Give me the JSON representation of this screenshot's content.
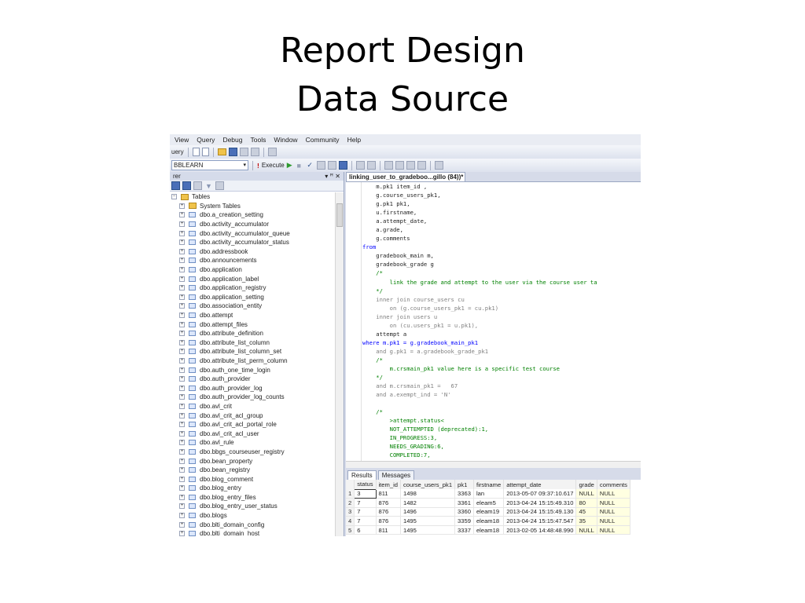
{
  "slide": {
    "title_line1": "Report Design",
    "title_line2": "Data Source"
  },
  "menu": [
    "View",
    "Query",
    "Debug",
    "Tools",
    "Window",
    "Community",
    "Help"
  ],
  "toolbar": {
    "query_label": "uery",
    "database": "BBLEARN",
    "execute_label": "Execute"
  },
  "explorer": {
    "title": "rer",
    "pin": "▾ ꟸ ✕",
    "root": "Tables",
    "items": [
      "System Tables",
      "dbo.a_creation_setting",
      "dbo.activity_accumulator",
      "dbo.activity_accumulator_queue",
      "dbo.activity_accumulator_status",
      "dbo.addressbook",
      "dbo.announcements",
      "dbo.application",
      "dbo.application_label",
      "dbo.application_registry",
      "dbo.application_setting",
      "dbo.association_entity",
      "dbo.attempt",
      "dbo.attempt_files",
      "dbo.attribute_definition",
      "dbo.attribute_list_column",
      "dbo.attribute_list_column_set",
      "dbo.attribute_list_perm_column",
      "dbo.auth_one_time_login",
      "dbo.auth_provider",
      "dbo.auth_provider_log",
      "dbo.auth_provider_log_counts",
      "dbo.avl_crit",
      "dbo.avl_crit_acl_group",
      "dbo.avl_crit_acl_portal_role",
      "dbo.avl_crit_acl_user",
      "dbo.avl_rule",
      "dbo.bbgs_courseuser_registry",
      "dbo.bean_property",
      "dbo.bean_registry",
      "dbo.blog_comment",
      "dbo.blog_entry",
      "dbo.blog_entry_files",
      "dbo.blog_entry_user_status",
      "dbo.blogs",
      "dbo.blti_domain_config",
      "dbo.blti_domain_host"
    ]
  },
  "editor": {
    "tab_label": "linking_user_to_gradeboo...gillo (84))*",
    "lines": [
      {
        "t": "    m.pk1 item_id ,",
        "c": ""
      },
      {
        "t": "    g.course_users_pk1,",
        "c": ""
      },
      {
        "t": "    g.pk1 pk1,",
        "c": ""
      },
      {
        "t": "    u.firstname,",
        "c": ""
      },
      {
        "t": "    a.attempt_date,",
        "c": ""
      },
      {
        "t": "    a.grade,",
        "c": ""
      },
      {
        "t": "    g.comments",
        "c": ""
      },
      {
        "t": "from",
        "c": "kw"
      },
      {
        "t": "    gradebook_main m,",
        "c": ""
      },
      {
        "t": "    gradebook_grade g",
        "c": ""
      },
      {
        "t": "    /*",
        "c": "cm"
      },
      {
        "t": "        link the grade and attempt to the user via the course user ta",
        "c": "cm"
      },
      {
        "t": "    */",
        "c": "cm"
      },
      {
        "t": "    inner join course_users cu",
        "c": "gr"
      },
      {
        "t": "        on (g.course_users_pk1 = cu.pk1)",
        "c": "gr"
      },
      {
        "t": "    inner join users u",
        "c": "gr"
      },
      {
        "t": "        on (cu.users_pk1 = u.pk1),",
        "c": "gr"
      },
      {
        "t": "    attempt a",
        "c": ""
      },
      {
        "t": "where m.pk1 = g.gradebook_main_pk1",
        "c": "kw"
      },
      {
        "t": "    and g.pk1 = a.gradebook_grade_pk1",
        "c": "gr"
      },
      {
        "t": "    /*",
        "c": "cm"
      },
      {
        "t": "        m.crsmain_pk1 value here is a specific test course",
        "c": "cm"
      },
      {
        "t": "    */",
        "c": "cm"
      },
      {
        "t": "    and m.crsmain_pk1 =   67",
        "c": "gr"
      },
      {
        "t": "    and a.exempt_ind = 'N'",
        "c": "gr"
      },
      {
        "t": "",
        "c": ""
      },
      {
        "t": "    /*",
        "c": "cm"
      },
      {
        "t": "        >attempt.status<",
        "c": "cm"
      },
      {
        "t": "        NOT_ATTEMPTED (deprecated):1,",
        "c": "cm"
      },
      {
        "t": "        IN_PROGRESS:3,",
        "c": "cm"
      },
      {
        "t": "        NEEDS_GRADING:6,",
        "c": "cm"
      },
      {
        "t": "        COMPLETED:7,",
        "c": "cm"
      }
    ]
  },
  "results": {
    "tab_results": "Results",
    "tab_messages": "Messages",
    "columns": [
      "",
      "status",
      "item_id",
      "course_users_pk1",
      "pk1",
      "firstname",
      "attempt_date",
      "grade",
      "comments"
    ],
    "rows": [
      [
        "1",
        "3",
        "811",
        "1498",
        "3363",
        "lan",
        "2013-05-07 09:37:10.617",
        "NULL",
        "NULL"
      ],
      [
        "2",
        "7",
        "876",
        "1482",
        "3361",
        "eleam5",
        "2013-04-24 15:15:49.310",
        "80",
        "NULL"
      ],
      [
        "3",
        "7",
        "876",
        "1496",
        "3360",
        "eleam19",
        "2013-04-24 15:15:49.130",
        "45",
        "NULL"
      ],
      [
        "4",
        "7",
        "876",
        "1495",
        "3359",
        "eleam18",
        "2013-04-24 15:15:47.547",
        "35",
        "NULL"
      ],
      [
        "5",
        "6",
        "811",
        "1495",
        "3337",
        "eleam18",
        "2013-02-05 14:48:48.990",
        "NULL",
        "NULL"
      ]
    ]
  }
}
